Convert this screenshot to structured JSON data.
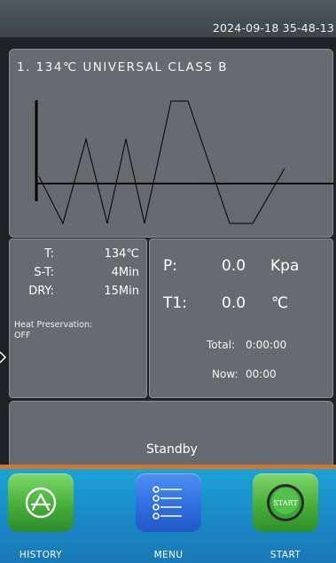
{
  "header": {
    "datetime": "2024-09-18  35-48-13"
  },
  "program": {
    "title": "1. 134℃ UNIVERSAL CLASS B"
  },
  "parameters": {
    "temperature": {
      "label": "T:",
      "value": "134℃"
    },
    "sterilization_time": {
      "label": "S-T:",
      "value": "4Min"
    },
    "dry_time": {
      "label": "DRY:",
      "value": "15Min"
    },
    "heat_preservation": {
      "label": "Heat Preservation:",
      "value": "OFF"
    }
  },
  "readouts": {
    "pressure": {
      "label": "P:",
      "value": "0.0",
      "unit": "Kpa"
    },
    "temperature_1": {
      "label": "T1:",
      "value": "0.0",
      "unit": "℃"
    },
    "total_time": {
      "label": "Total:",
      "value": "0:00:00"
    },
    "now_time": {
      "label": "Now:",
      "value": "00:00"
    }
  },
  "status": {
    "text": "Standby"
  },
  "dock": {
    "history_label": "HISTORY",
    "menu_label": "MENU",
    "start_label": "START",
    "start_icon_text": "START",
    "history_icon": "app-store-icon",
    "menu_icon": "list-icon",
    "start_icon": "start-button-icon"
  },
  "colors": {
    "accent": "#d3752b",
    "dock": "#1b86c4",
    "panel": "#656b70"
  }
}
